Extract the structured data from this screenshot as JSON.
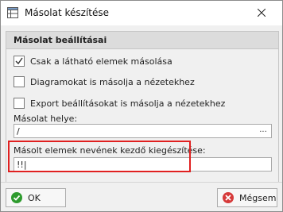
{
  "window": {
    "title": "Másolat készítése",
    "close_icon": "close-icon"
  },
  "group": {
    "title": "Másolat beállításai"
  },
  "options": [
    {
      "label": "Csak a látható elemek másolása",
      "checked": true
    },
    {
      "label": "Diagramokat is másolja a nézetekhez",
      "checked": false
    },
    {
      "label": "Export beállításokat is másolja a nézetekhez",
      "checked": false
    }
  ],
  "location": {
    "label": "Másolat helye:",
    "value": "/",
    "browse": "..."
  },
  "suffix": {
    "label": "Másolt elemek nevének kezdő kiegészítése:",
    "value": "!!|"
  },
  "buttons": {
    "ok": "OK",
    "cancel": "Mégsem"
  },
  "colors": {
    "highlight": "#e02020",
    "ok_icon": "#2e9b2e",
    "cancel_icon": "#d63a3a"
  }
}
